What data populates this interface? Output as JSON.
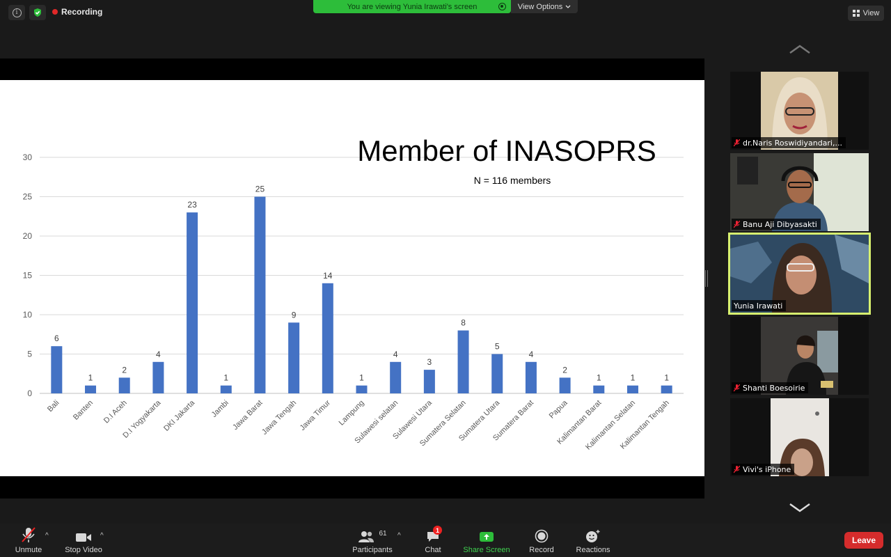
{
  "top": {
    "recording_label": "Recording",
    "viewing_banner": "You are viewing Yunia Irawati's screen",
    "view_options_label": "View Options",
    "view_label": "View"
  },
  "chart_data": {
    "type": "bar",
    "title": "Member of INASOPRS",
    "subtitle": "N = 116 members",
    "categories": [
      "Bali",
      "Banten",
      "D.I Aceh",
      "D.I Yogyakarta",
      "DKI Jakarta",
      "Jambi",
      "Jawa Barat",
      "Jawa Tengah",
      "Jawa Timur",
      "Lampung",
      "Sulawesi selatan",
      "Sulawesi Utara",
      "Sumatera Selatan",
      "Sumatera Utara",
      "Sumatera Barat",
      "Papua",
      "Kalimantan Barat",
      "Kalimantan Selatan",
      "Kalimantan Tengah"
    ],
    "values": [
      6,
      1,
      2,
      4,
      23,
      1,
      25,
      9,
      14,
      1,
      4,
      3,
      8,
      5,
      4,
      2,
      1,
      1,
      1
    ],
    "yticks": [
      0,
      5,
      10,
      15,
      20,
      25,
      30
    ],
    "ylim": [
      0,
      30
    ],
    "grid": true,
    "bar_color": "#4472c4",
    "xlabel": "",
    "ylabel": ""
  },
  "participants": [
    {
      "name": "dr.Naris Roswidiyandari,...",
      "muted": true
    },
    {
      "name": "Banu Aji Dibyasakti",
      "muted": true
    },
    {
      "name": "Yunia Irawati",
      "muted": false,
      "active": true
    },
    {
      "name": "Shanti Boesoirie",
      "muted": true
    },
    {
      "name": "Vivi's iPhone",
      "muted": true
    }
  ],
  "toolbar": {
    "unmute_label": "Unmute",
    "stop_video_label": "Stop Video",
    "participants_label": "Participants",
    "participants_count": "61",
    "chat_label": "Chat",
    "chat_badge": "1",
    "share_screen_label": "Share Screen",
    "record_label": "Record",
    "reactions_label": "Reactions",
    "leave_label": "Leave"
  },
  "colors": {
    "banner_green": "#2dbd3a",
    "leave_red": "#d52c2c",
    "active_speaker": "#d7f06f"
  }
}
